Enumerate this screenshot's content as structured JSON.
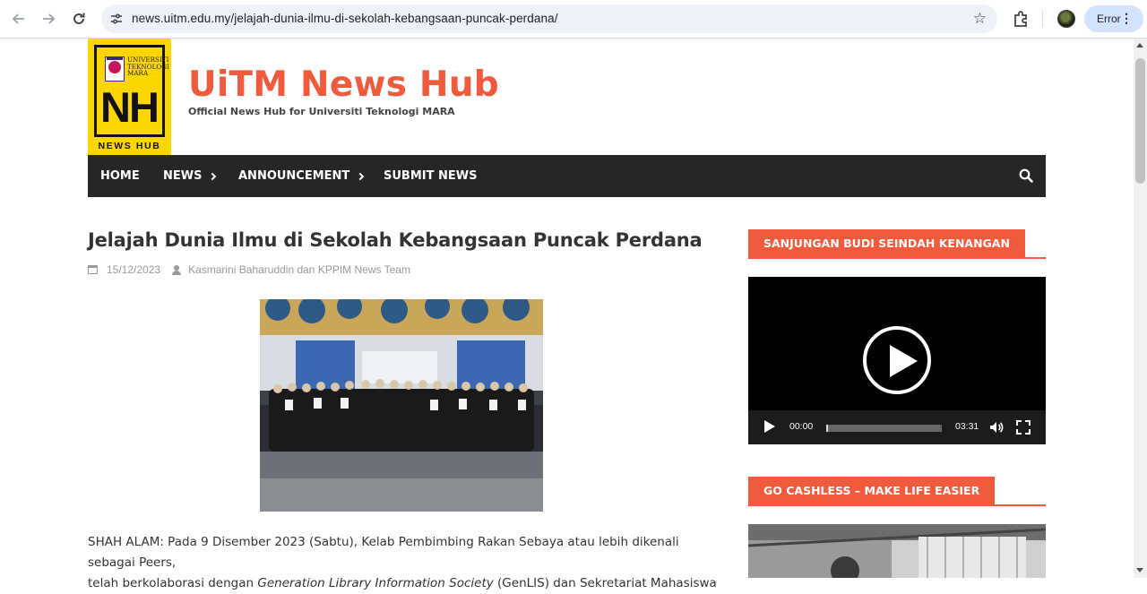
{
  "browser": {
    "url": "news.uitm.edu.my/jelajah-dunia-ilmu-di-sekolah-kebangsaan-puncak-perdana/",
    "profile_status": "Error"
  },
  "site": {
    "logo_university": "UNIVERSITI TEKNOLOGI MARA",
    "logo_letters": "NH",
    "logo_caption": "NEWS HUB",
    "title": "UiTM News Hub",
    "tagline": "Official News Hub for Universiti Teknologi MARA",
    "accent_color": "#f05a3d",
    "logo_color": "#fdd600"
  },
  "nav": {
    "items": [
      {
        "label": "HOME",
        "has_dropdown": false
      },
      {
        "label": "NEWS",
        "has_dropdown": true
      },
      {
        "label": "ANNOUNCEMENT",
        "has_dropdown": true
      },
      {
        "label": "SUBMIT NEWS",
        "has_dropdown": false
      }
    ],
    "search_icon": "search-icon"
  },
  "post": {
    "title": "Jelajah Dunia Ilmu di Sekolah Kebangsaan Puncak Perdana",
    "date": "15/12/2023",
    "author": "Kasmarini Baharuddin dan KPPIM News Team",
    "paragraph_1a": "SHAH ALAM: Pada 9 Disember 2023 (Sabtu), Kelab Pembimbing Rakan Sebaya atau lebih dikenali sebagai Peers,",
    "paragraph_1b_pre": "telah berkolaborasi dengan ",
    "paragraph_1b_em": "Generation Library Information Society",
    "paragraph_1b_post": " (GenLIS) dan Sekretariat Mahasiswa"
  },
  "sidebar": {
    "widget_1_title": "SANJUNGAN BUDI SEINDAH KENANGAN",
    "video": {
      "current_time": "00:00",
      "duration": "03:31",
      "progress": 0.0
    },
    "widget_2_title": "GO CASHLESS – MAKE LIFE EASIER"
  }
}
